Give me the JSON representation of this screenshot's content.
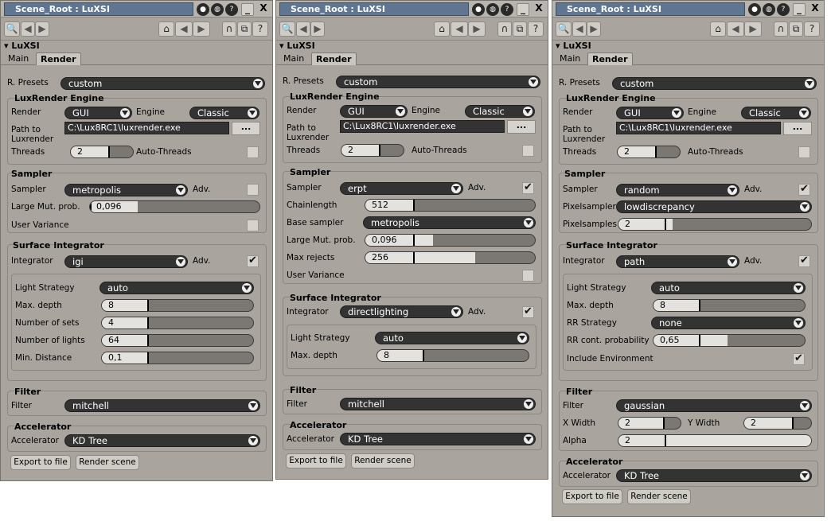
{
  "window_title": "Scene_Root : LuXSI",
  "section_title": "LuXSI",
  "tabs": {
    "main": "Main",
    "render": "Render"
  },
  "labels": {
    "r_presets": "R. Presets",
    "luxrender_engine": "LuxRender Engine",
    "render": "Render",
    "engine": "Engine",
    "path_to": "Path to",
    "luxrender": "Luxrender",
    "threads": "Threads",
    "auto_threads": "Auto-Threads",
    "sampler_group": "Sampler",
    "sampler": "Sampler",
    "adv": "Adv.",
    "large_mut": "Large Mut. prob.",
    "user_variance": "User Variance",
    "chainlength": "Chainlength",
    "base_sampler": "Base sampler",
    "max_rejects": "Max rejects",
    "pixelsampler": "Pixelsampler",
    "pixelsamples": "Pixelsamples",
    "surface_integrator": "Surface Integrator",
    "integrator": "Integrator",
    "light_strategy": "Light Strategy",
    "max_depth": "Max. depth",
    "number_of_sets": "Number of sets",
    "number_of_lights": "Number of lights",
    "min_distance": "Min. Distance",
    "rr_strategy": "RR Strategy",
    "rr_cont": "RR cont. probability",
    "include_env": "Include Environment",
    "filter_group": "Filter",
    "filter": "Filter",
    "x_width": "X Width",
    "y_width": "Y Width",
    "alpha": "Alpha",
    "accelerator_group": "Accelerator",
    "accelerator": "Accelerator",
    "export": "Export to file",
    "render_scene": "Render scene",
    "ellipsis": "..."
  },
  "common": {
    "preset": "custom",
    "render_mode": "GUI",
    "engine": "Classic",
    "path": "C:\\Lux8RC1\\luxrender.exe",
    "threads": "2",
    "accelerator": "KD Tree"
  },
  "panel1": {
    "sampler": "metropolis",
    "large_mut": "0,096",
    "large_mut_level": 0.28,
    "integrator": "igi",
    "light_strategy": "auto",
    "max_depth": "8",
    "number_of_sets": "4",
    "number_of_lights": "64",
    "min_distance": "0,1",
    "filter": "mitchell"
  },
  "panel2": {
    "sampler": "erpt",
    "chainlength": "512",
    "base_sampler": "metropolis",
    "large_mut": "0,096",
    "large_mut_level": 0.4,
    "max_rejects": "256",
    "max_rejects_level": 0.65,
    "integrator": "directlighting",
    "light_strategy": "auto",
    "max_depth": "8",
    "filter": "mitchell"
  },
  "panel3": {
    "sampler": "random",
    "pixelsampler": "lowdiscrepancy",
    "pixelsamples": "2",
    "integrator": "path",
    "light_strategy": "auto",
    "max_depth": "8",
    "rr_strategy": "none",
    "rr_cont": "0,65",
    "rr_cont_level": 0.49,
    "filter": "gaussian",
    "x_width": "2",
    "y_width": "2",
    "alpha": "2"
  },
  "icons": {
    "camera": "camera-icon",
    "globe": "globe-icon",
    "question": "help-icon",
    "min": "minimize-icon",
    "close": "close-icon",
    "magnet": "magnet-icon",
    "lock": "lock-icon"
  },
  "title_buttons": {
    "min": "_",
    "close": "X"
  },
  "toolbar_glyphs": {
    "search": "🔍",
    "back": "◀",
    "forward": "▶",
    "home": "⌂",
    "magnet": "∩",
    "copy": "⧉",
    "help": "?"
  }
}
